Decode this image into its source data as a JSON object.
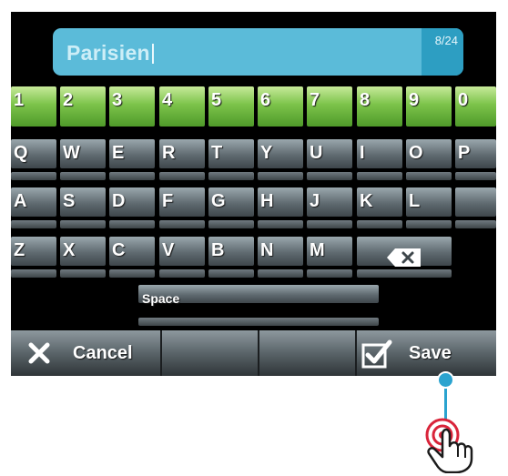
{
  "input": {
    "text": "Parisien",
    "counter": "8/24"
  },
  "keyboard": {
    "number_row": [
      "1",
      "2",
      "3",
      "4",
      "5",
      "6",
      "7",
      "8",
      "9",
      "0"
    ],
    "row_q": [
      "Q",
      "W",
      "E",
      "R",
      "T",
      "Y",
      "U",
      "I",
      "O",
      "P"
    ],
    "row_a": [
      "A",
      "S",
      "D",
      "F",
      "G",
      "H",
      "J",
      "K",
      "L"
    ],
    "row_z": [
      "Z",
      "X",
      "C",
      "V",
      "B",
      "N",
      "M"
    ],
    "space_label": "Space",
    "backspace_icon": "backspace-icon"
  },
  "actions": {
    "cancel_label": "Cancel",
    "cancel_icon": "close-icon",
    "save_label": "Save",
    "save_icon": "checkbox-check-icon"
  },
  "colors": {
    "input_bg": "#5bbbd9",
    "number_key": "#7cc34a",
    "tap_indicator": "#2aa3cf",
    "tap_ring": "#d9243a"
  }
}
